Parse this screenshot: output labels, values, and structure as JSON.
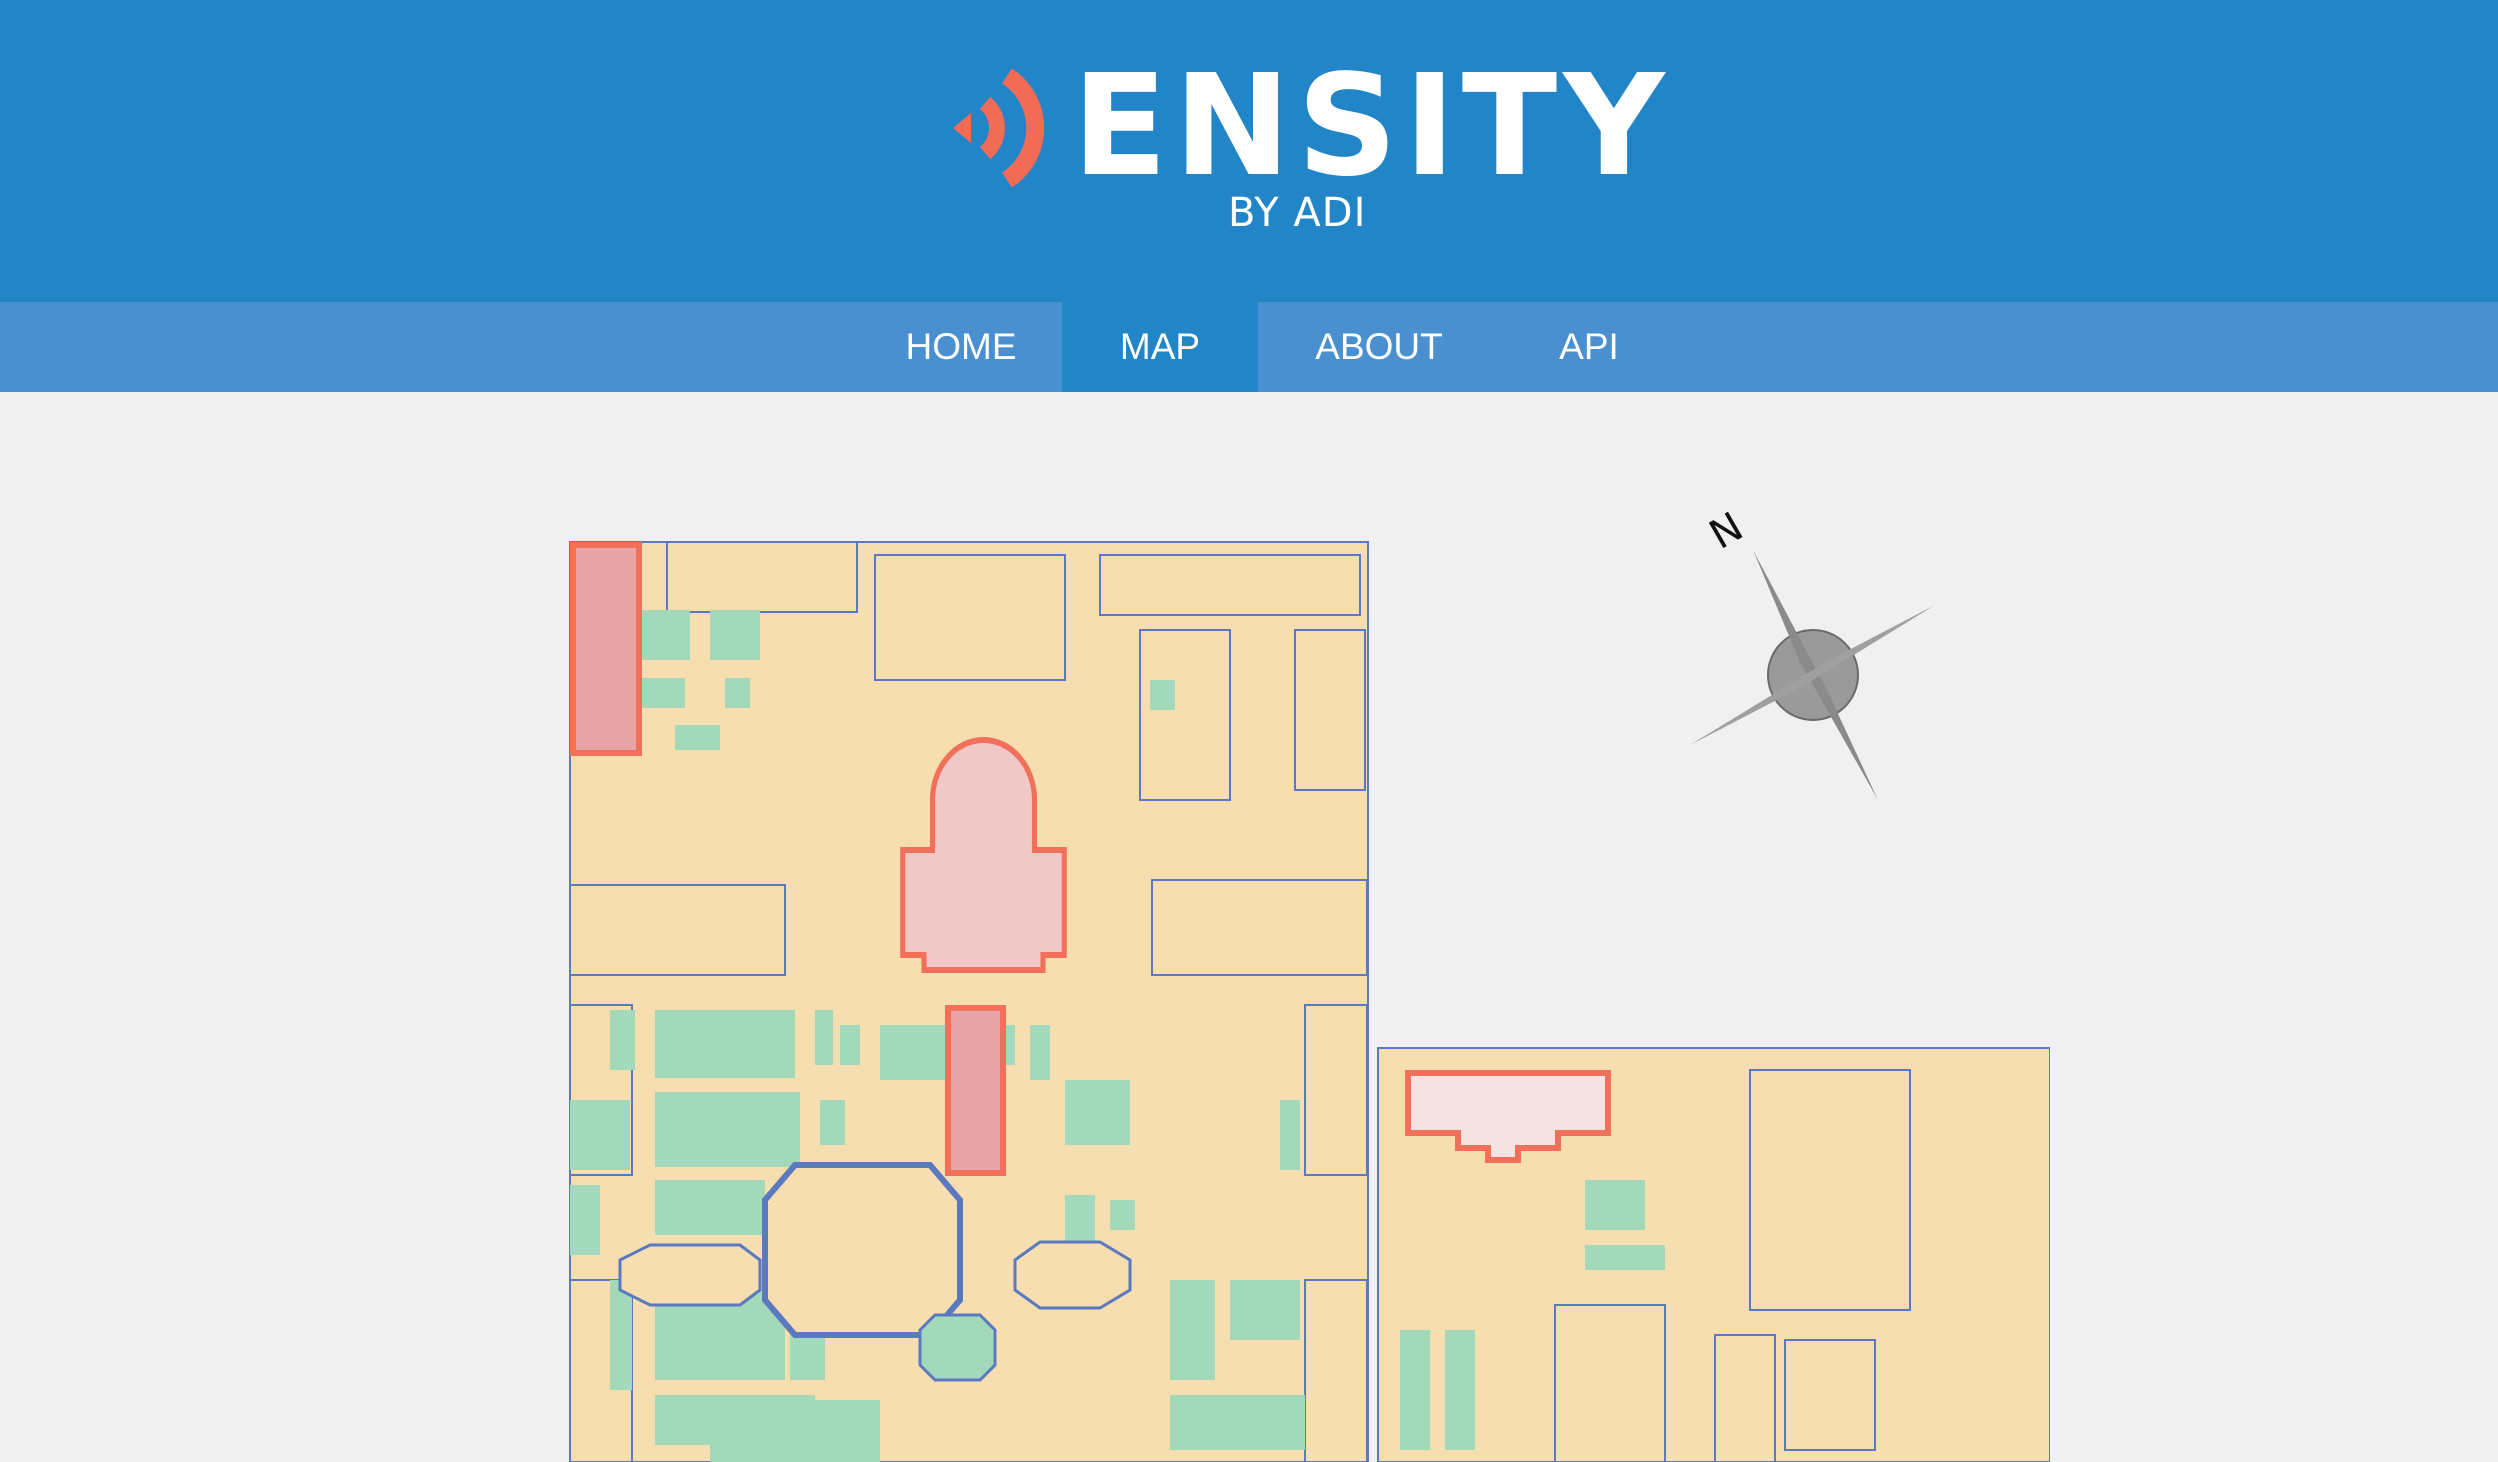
{
  "header": {
    "logo_text": "ENSITY",
    "logo_subtitle": "BY ADI",
    "logo_icon": "signal-waves-icon",
    "accent_color": "#f26b55",
    "brand_color": "#2285c8"
  },
  "nav": {
    "items": [
      {
        "label": "HOME",
        "active": false
      },
      {
        "label": "MAP",
        "active": true
      },
      {
        "label": "ABOUT",
        "active": false
      },
      {
        "label": "API",
        "active": false
      }
    ]
  },
  "map": {
    "compass_label": "N",
    "building_color": "#f6deb0",
    "lawn_color": "#a2d9bb",
    "outline_color": "#5a79c0",
    "highlight_color": "#f0705a",
    "highlight_fill": "#f0c8c8"
  }
}
